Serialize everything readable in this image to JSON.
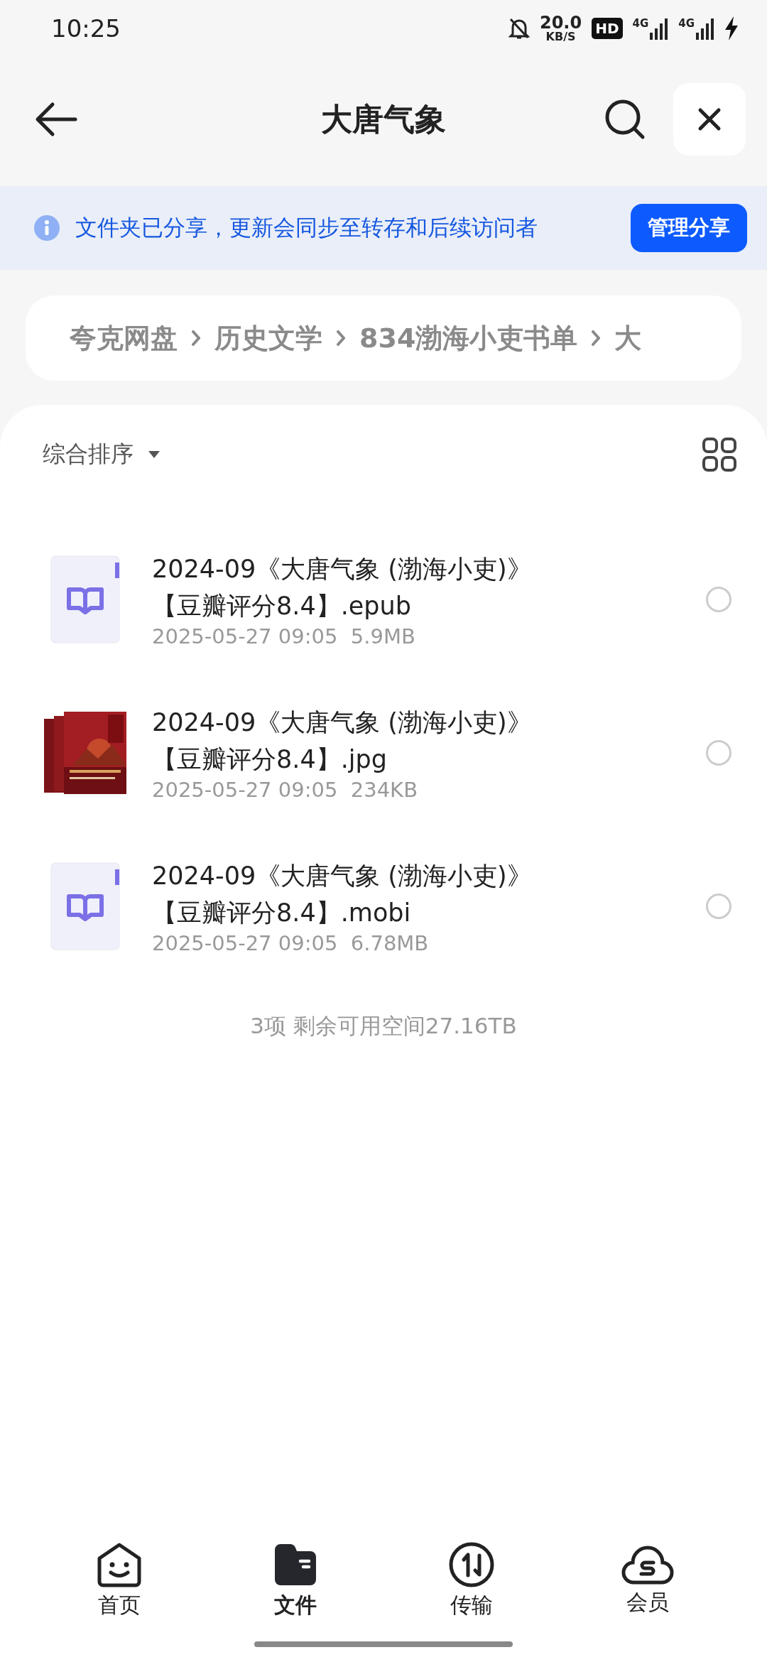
{
  "status_bar": {
    "time": "10:25",
    "speed": "20.0",
    "speed_unit": "KB/S",
    "hd": "HD",
    "networks": [
      {
        "label": "4G"
      },
      {
        "label": "4G"
      }
    ]
  },
  "header": {
    "title": "大唐气象"
  },
  "banner": {
    "message": "文件夹已分享，更新会同步至转存和后续访问者",
    "button": "管理分享"
  },
  "breadcrumb": [
    "夸克网盘",
    "历史文学",
    "834渤海小吏书单",
    "大"
  ],
  "sort": {
    "label": "综合排序"
  },
  "files": [
    {
      "kind": "ebook",
      "name": "2024-09《大唐气象 (渤海小吏)》【豆瓣评分8.4】.epub",
      "date": "2025-05-27 09:05",
      "size": "5.9MB",
      "selected": false
    },
    {
      "kind": "picture",
      "name": "2024-09《大唐气象 (渤海小吏)》【豆瓣评分8.4】.jpg",
      "date": "2025-05-27 09:05",
      "size": "234KB",
      "selected": false
    },
    {
      "kind": "ebook",
      "name": "2024-09《大唐气象 (渤海小吏)》【豆瓣评分8.4】.mobi",
      "date": "2025-05-27 09:05",
      "size": "6.78MB",
      "selected": false
    }
  ],
  "summary": "3项 剩余可用空间27.16TB",
  "tabs": [
    {
      "label": "首页",
      "selected": false
    },
    {
      "label": "文件",
      "selected": true
    },
    {
      "label": "传输",
      "selected": false
    },
    {
      "label": "会员",
      "selected": false
    }
  ]
}
